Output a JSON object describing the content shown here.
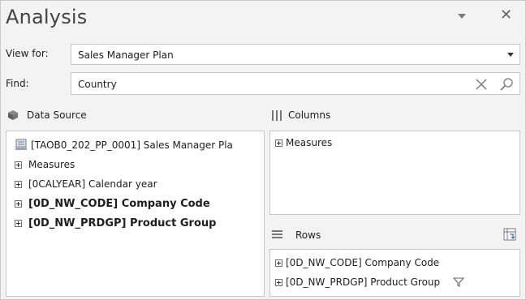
{
  "panel": {
    "title": "Analysis"
  },
  "view_for": {
    "label": "View for:",
    "value": "Sales Manager Plan"
  },
  "find": {
    "label": "Find:",
    "value": "Country"
  },
  "data_source": {
    "heading": "Data Source",
    "root": "[TAOB0_202_PP_0001] Sales Manager Pla",
    "items": [
      "Measures",
      "[0CALYEAR] Calendar year",
      "[0D_NW_CODE] Company Code",
      "[0D_NW_PRDGP] Product Group"
    ]
  },
  "columns": {
    "heading": "Columns",
    "items": [
      "Measures"
    ]
  },
  "rows": {
    "heading": "Rows",
    "items": [
      "[0D_NW_CODE] Company Code",
      "[0D_NW_PRDGP] Product Group"
    ]
  }
}
